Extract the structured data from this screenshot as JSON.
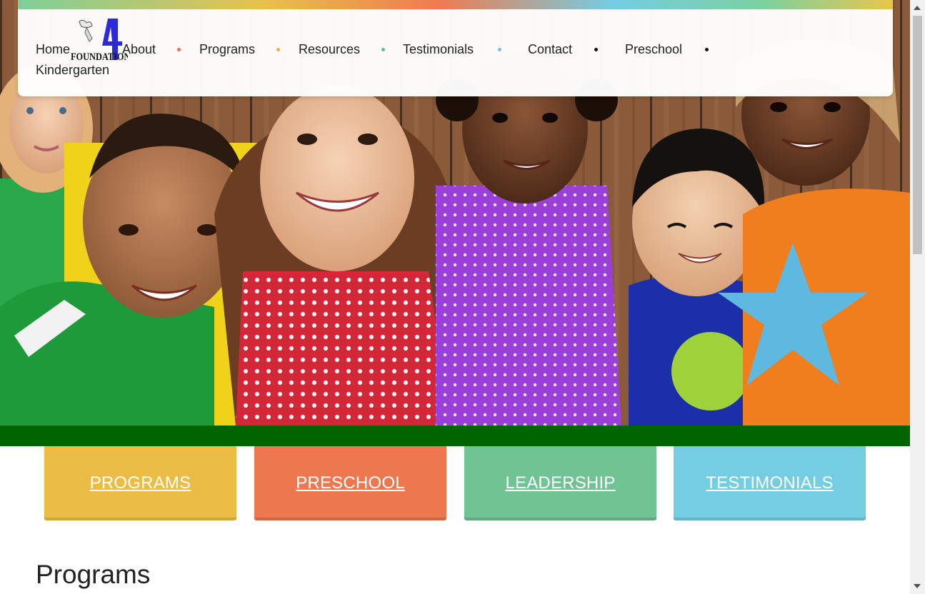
{
  "brand": {
    "logo_text": "FOUNDATION",
    "logo_numeral": "4",
    "logo_alt": "Foundation 4 logo"
  },
  "nav": {
    "items": [
      {
        "label": "Home"
      },
      {
        "label": "About"
      },
      {
        "label": "Programs"
      },
      {
        "label": "Resources"
      },
      {
        "label": "Testimonials"
      },
      {
        "label": "Contact"
      },
      {
        "label": "Preschool"
      },
      {
        "label": "Kindergarten"
      }
    ],
    "separator_colors": [
      "#ee6b5a",
      "#f0b13b",
      "#5fc08a",
      "#6cc8e0",
      "#111111",
      "#111111"
    ]
  },
  "hero": {
    "image_icon": "children-group-photo",
    "band_color": "#006400"
  },
  "tiles": [
    {
      "label": "PROGRAMS",
      "color": "#ecbd45"
    },
    {
      "label": "PRESCHOOL",
      "color": "#ec7850"
    },
    {
      "label": "LEADERSHIP",
      "color": "#70c392"
    },
    {
      "label": "TESTIMONIALS",
      "color": "#75cde2"
    }
  ],
  "section": {
    "title": "Programs"
  }
}
